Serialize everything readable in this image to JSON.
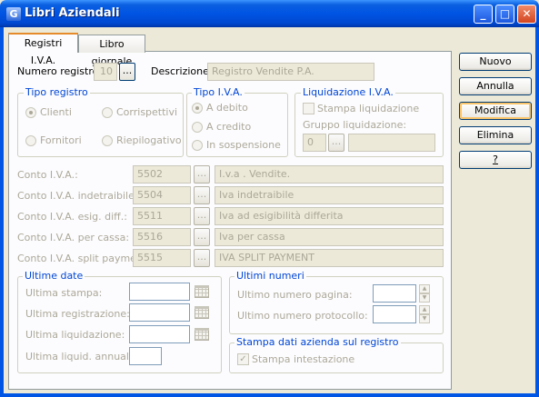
{
  "window": {
    "title": "Libri Aziendali",
    "icon_text": "G",
    "minimize": "_",
    "maximize": "□",
    "close": "✕"
  },
  "tabs": [
    {
      "label": "Registri I.V.A."
    },
    {
      "label": "Libro giornale"
    }
  ],
  "buttons": {
    "nuovo": "Nuovo",
    "annulla": "Annulla",
    "modifica": "Modifica",
    "elimina": "Elimina",
    "help": "?"
  },
  "numero_registro": {
    "label": "Numero registro:",
    "value": "10",
    "lookup": "..."
  },
  "descrizione": {
    "label": "Descrizione:",
    "value": "Registro Vendite P.A."
  },
  "tipo_registro": {
    "legend": "Tipo registro",
    "options": [
      {
        "label": "Clienti",
        "checked": true
      },
      {
        "label": "Corrispettivi",
        "checked": false
      },
      {
        "label": "Fornitori",
        "checked": false
      },
      {
        "label": "Riepilogativo",
        "checked": false
      }
    ]
  },
  "tipo_iva": {
    "legend": "Tipo I.V.A.",
    "options": [
      {
        "label": "A debito",
        "checked": true
      },
      {
        "label": "A credito",
        "checked": false
      },
      {
        "label": "In sospensione",
        "checked": false
      }
    ]
  },
  "liquidazione": {
    "legend": "Liquidazione I.V.A.",
    "stampa_label": "Stampa liquidazione",
    "gruppo_label": "Gruppo liquidazione:",
    "gruppo_value": "0",
    "lookup": "...",
    "gruppo_desc": ""
  },
  "conti": [
    {
      "label": "Conto I.V.A.:",
      "code": "5502",
      "lookup": "...",
      "desc": "I.v.a . Vendite."
    },
    {
      "label": "Conto I.V.A. indetraibile:",
      "code": "5504",
      "lookup": "...",
      "desc": "Iva indetraibile"
    },
    {
      "label": "Conto I.V.A. esig. diff.:",
      "code": "5511",
      "lookup": "...",
      "desc": "Iva ad esigibilità differita"
    },
    {
      "label": "Conto I.V.A. per cassa:",
      "code": "5516",
      "lookup": "...",
      "desc": "Iva per cassa"
    },
    {
      "label": "Conto I.V.A. split payment:",
      "code": "5515",
      "lookup": "...",
      "desc": "IVA SPLIT PAYMENT"
    }
  ],
  "ultime_date": {
    "legend": "Ultime date",
    "rows": [
      {
        "label": "Ultima stampa:",
        "value": ""
      },
      {
        "label": "Ultima registrazione:",
        "value": ""
      },
      {
        "label": "Ultima liquidazione:",
        "value": ""
      },
      {
        "label": "Ultima liquid. annuale:",
        "value": ""
      }
    ]
  },
  "ultimi_numeri": {
    "legend": "Ultimi numeri",
    "rows": [
      {
        "label": "Ultimo numero pagina:",
        "value": ""
      },
      {
        "label": "Ultimo numero protocollo:",
        "value": ""
      }
    ]
  },
  "stampa_dati": {
    "legend": "Stampa dati azienda sul registro",
    "label": "Stampa intestazione",
    "checked": true
  },
  "colors": {
    "titlebar": "#0054e3",
    "legend": "#0046d5",
    "disabled_text": "#aca899",
    "tab_accent": "#e68b2c"
  }
}
